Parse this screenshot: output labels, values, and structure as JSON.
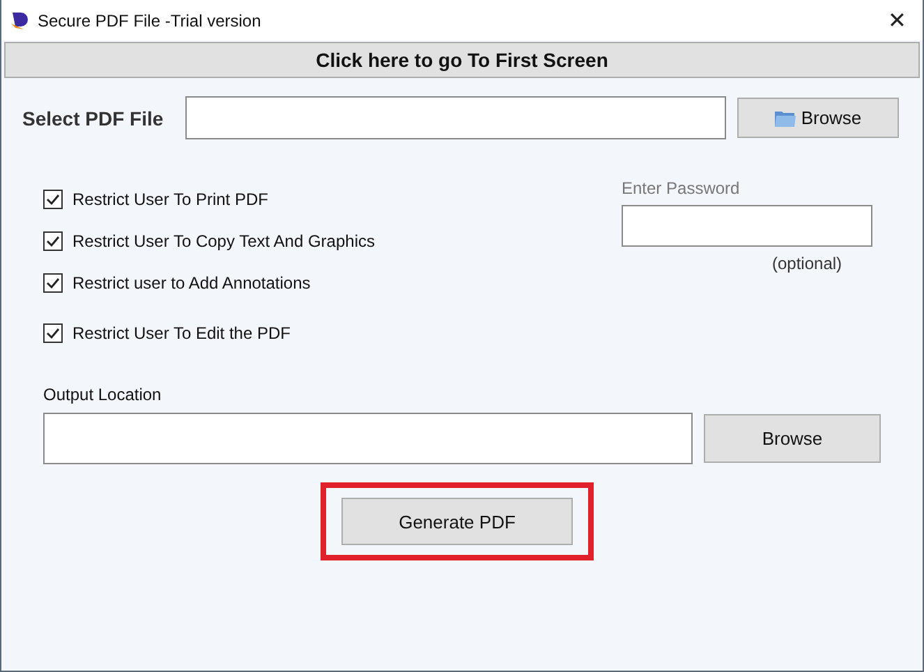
{
  "window": {
    "title": "Secure PDF File -Trial version",
    "close": "✕"
  },
  "first_screen_button": "Click here to go To First Screen",
  "select_file": {
    "label": "Select PDF File",
    "browse": "Browse"
  },
  "options": [
    {
      "label": "Restrict User To Print PDF",
      "checked": true
    },
    {
      "label": "Restrict User To Copy Text And Graphics",
      "checked": true
    },
    {
      "label": "Restrict user to Add Annotations",
      "checked": true
    },
    {
      "label": "Restrict User To Edit the PDF",
      "checked": true
    }
  ],
  "password": {
    "label": "Enter Password",
    "hint": "(optional)"
  },
  "output": {
    "label": "Output Location",
    "browse": "Browse"
  },
  "generate": {
    "label": "Generate PDF",
    "highlighted": true
  }
}
